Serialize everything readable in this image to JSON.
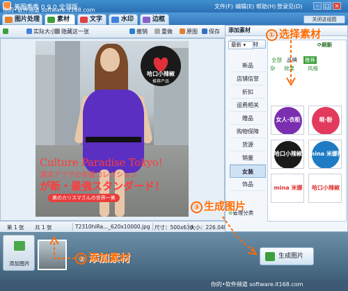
{
  "watermark_top": "你的•软件频道 software.it168.com",
  "app": {
    "title": "美图秀秀 0.9.0 全测版"
  },
  "menu": [
    "文件(F)",
    "编辑(E)",
    "帮助(H)",
    "登录见(D)"
  ],
  "tabs": [
    "图片处理",
    "素材",
    "文字",
    "水印",
    "边框"
  ],
  "feedback": "关闭这组图",
  "toolbar": {
    "actual_size": "实际大小",
    "hide_tip": "隐藏这一张",
    "undo": "撤销",
    "redo": "重做",
    "original": "原图",
    "save": "保存"
  },
  "photo_overlay": {
    "stamp_title": "哈口小辣椒",
    "stamp_sub": "推荐产品",
    "line1": "Culture Paradise Tokyo!",
    "line2": "浦浜アリサの冬服コレクション",
    "line3": "が新・最強スタンダード！",
    "line4": "美のカリスマさんの世界一美"
  },
  "status": {
    "page": "第 1 张",
    "total": "共 1 张",
    "file": "T2310hiRa..._620x10000.jpg",
    "size": "尺寸：500x636",
    "filesize": "大小：226.04K"
  },
  "panel": {
    "header": "添加素材",
    "online_button": "在线素材",
    "categories": [
      "新品",
      "店铺信誉",
      "折扣",
      "运费相关",
      "赠品",
      "购物保障",
      "货源",
      "销量",
      "女装",
      "饰品"
    ],
    "active_category": "女装",
    "manage": "管理分类",
    "sort": "最新",
    "refresh": "刷新",
    "filter_all": "全部",
    "filter_brand": "品牌",
    "filter_recommend": "推荐",
    "filter_line2a": "杂",
    "filter_line2b": "效果",
    "filter_line2c": "风格",
    "thumbs": [
      "女人·衣柜",
      "萌·粉",
      "哈口小辣椒",
      "mina 米娜推荐",
      "mina 米娜",
      "哈口小辣椒"
    ]
  },
  "bottom": {
    "add_label": "添加图片",
    "generate": "生成图片"
  },
  "annotations": {
    "step1": "选择素材",
    "step2": "添加素材",
    "step3": "生成图片",
    "n1": "①",
    "n2": "②",
    "n3": "③"
  },
  "watermark_bottom": "你的•软件频道 software.it168.com",
  "colors": {
    "accent": "#ff6a00",
    "titlebar": "#2a6fb3",
    "dress": "#5a2fc2"
  }
}
